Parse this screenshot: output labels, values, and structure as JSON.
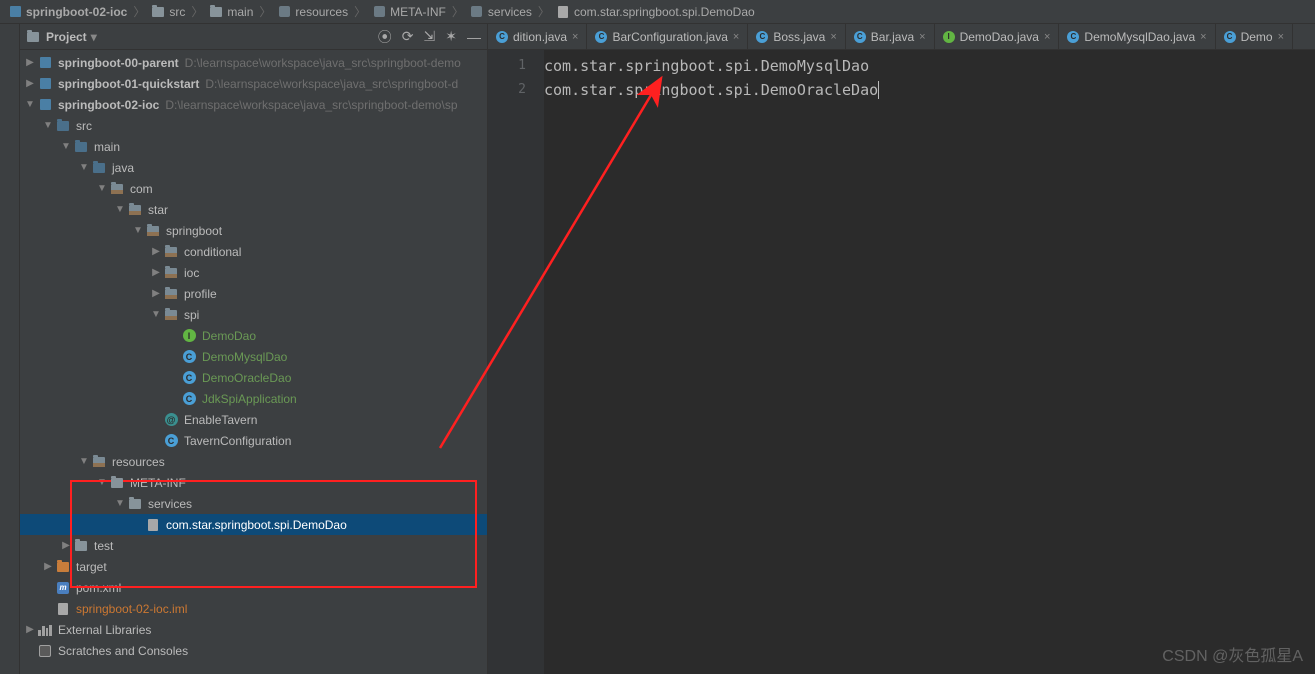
{
  "breadcrumb": [
    {
      "icon": "module",
      "text": "springboot-02-ioc"
    },
    {
      "icon": "folder",
      "text": "src"
    },
    {
      "icon": "folder",
      "text": "main"
    },
    {
      "icon": "pkg",
      "text": "resources"
    },
    {
      "icon": "pkg",
      "text": "META-INF"
    },
    {
      "icon": "pkg",
      "text": "services"
    },
    {
      "icon": "file",
      "text": "com.star.springboot.spi.DemoDao"
    }
  ],
  "sidebar": {
    "title": "Project",
    "tools": {
      "locate": "⦿",
      "reload": "⟳",
      "collapse": "⇲",
      "settings": "✶",
      "hide": "—"
    }
  },
  "tree": [
    {
      "ind": 0,
      "arrow": "right",
      "icon": "module",
      "text": "springboot-00-parent",
      "dim": "D:\\learnspace\\workspace\\java_src\\springboot-demo"
    },
    {
      "ind": 0,
      "arrow": "right",
      "icon": "module",
      "text": "springboot-01-quickstart",
      "dim": "D:\\learnspace\\workspace\\java_src\\springboot-d"
    },
    {
      "ind": 0,
      "arrow": "down",
      "icon": "module",
      "text": "springboot-02-ioc",
      "dim": "D:\\learnspace\\workspace\\java_src\\springboot-demo\\sp"
    },
    {
      "ind": 1,
      "arrow": "down",
      "icon": "dir-blue",
      "text": "src"
    },
    {
      "ind": 2,
      "arrow": "down",
      "icon": "dir-blue",
      "text": "main"
    },
    {
      "ind": 3,
      "arrow": "down",
      "icon": "dir-blue",
      "text": "java"
    },
    {
      "ind": 4,
      "arrow": "down",
      "icon": "pkg",
      "text": "com"
    },
    {
      "ind": 5,
      "arrow": "down",
      "icon": "pkg",
      "text": "star"
    },
    {
      "ind": 6,
      "arrow": "down",
      "icon": "pkg",
      "text": "springboot"
    },
    {
      "ind": 7,
      "arrow": "right",
      "icon": "pkg",
      "text": "conditional"
    },
    {
      "ind": 7,
      "arrow": "right",
      "icon": "pkg",
      "text": "ioc"
    },
    {
      "ind": 7,
      "arrow": "right",
      "icon": "pkg",
      "text": "profile"
    },
    {
      "ind": 7,
      "arrow": "down",
      "icon": "pkg",
      "text": "spi"
    },
    {
      "ind": 8,
      "arrow": "blank",
      "icon": "c-green",
      "text": "DemoDao",
      "green": true
    },
    {
      "ind": 8,
      "arrow": "blank",
      "icon": "c-blue",
      "text": "DemoMysqlDao",
      "green": true
    },
    {
      "ind": 8,
      "arrow": "blank",
      "icon": "c-blue",
      "text": "DemoOracleDao",
      "green": true
    },
    {
      "ind": 8,
      "arrow": "blank",
      "icon": "c-blue",
      "text": "JdkSpiApplication",
      "green": true
    },
    {
      "ind": 7,
      "arrow": "blank",
      "icon": "c-teal",
      "text": "EnableTavern"
    },
    {
      "ind": 7,
      "arrow": "blank",
      "icon": "c-blue",
      "text": "TavernConfiguration"
    },
    {
      "ind": 3,
      "arrow": "down",
      "icon": "pkg",
      "text": "resources"
    },
    {
      "ind": 4,
      "arrow": "down",
      "icon": "dir",
      "text": "META-INF"
    },
    {
      "ind": 5,
      "arrow": "down",
      "icon": "dir",
      "text": "services"
    },
    {
      "ind": 6,
      "arrow": "blank",
      "icon": "file",
      "text": "com.star.springboot.spi.DemoDao",
      "selected": true
    },
    {
      "ind": 2,
      "arrow": "right",
      "icon": "dir",
      "text": "test"
    },
    {
      "ind": 1,
      "arrow": "right",
      "icon": "dir-orange",
      "text": "target"
    },
    {
      "ind": 1,
      "arrow": "blank",
      "icon": "xml",
      "text": "pom.xml"
    },
    {
      "ind": 1,
      "arrow": "blank",
      "icon": "file",
      "text": "springboot-02-ioc.iml",
      "orange": true
    },
    {
      "ind": 0,
      "arrow": "right",
      "icon": "lib",
      "text": "External Libraries"
    },
    {
      "ind": 0,
      "arrow": "blank",
      "icon": "scr",
      "text": "Scratches and Consoles"
    }
  ],
  "tabs": [
    {
      "icon": "tc-blue",
      "text": "dition.java"
    },
    {
      "icon": "tc-blue",
      "text": "BarConfiguration.java"
    },
    {
      "icon": "tc-blue",
      "text": "Boss.java"
    },
    {
      "icon": "tc-blue",
      "text": "Bar.java"
    },
    {
      "icon": "tc-green",
      "text": "DemoDao.java"
    },
    {
      "icon": "tc-blue",
      "text": "DemoMysqlDao.java"
    },
    {
      "icon": "tc-blue",
      "text": "Demo"
    }
  ],
  "editor": {
    "lines": [
      "com.star.springboot.spi.DemoMysqlDao",
      "com.star.springboot.spi.DemoOracleDao"
    ],
    "lineNumbers": [
      "1",
      "2"
    ]
  },
  "watermark": "CSDN @灰色孤星A"
}
